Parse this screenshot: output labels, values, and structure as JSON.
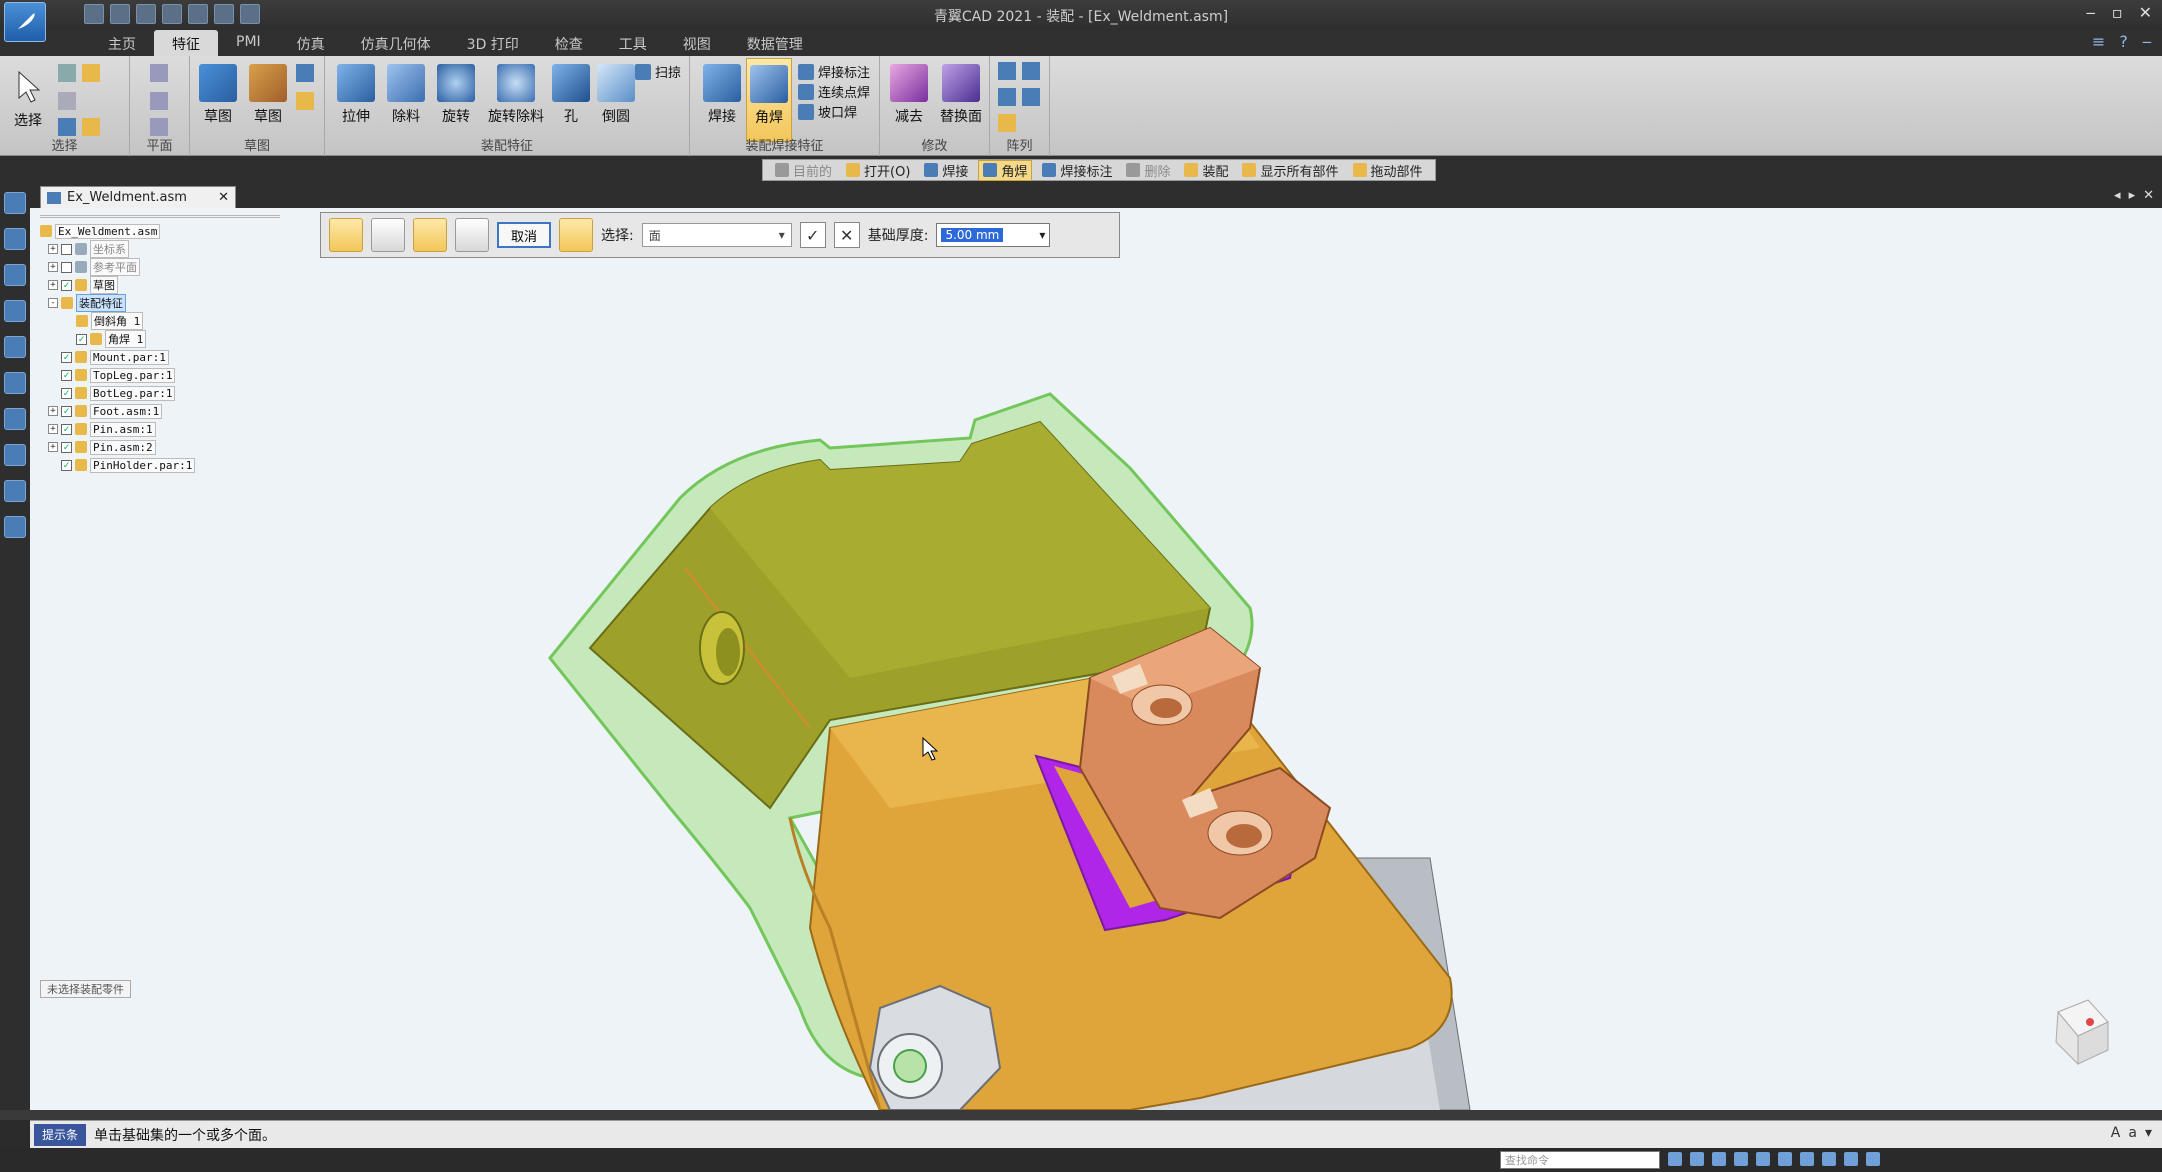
{
  "app": {
    "window_title": "青翼CAD 2021 - 装配 - [Ex_Weldment.asm]"
  },
  "ribbon_tabs": [
    "主页",
    "PMI",
    "仿真",
    "仿真几何体",
    "3D 打印",
    "检查",
    "工具",
    "视图",
    "数据管理"
  ],
  "active_tab": "特征",
  "ribbon": {
    "select_group": {
      "label": "选择",
      "button": "选择"
    },
    "plane_group": {
      "label": "平面"
    },
    "sketch_group": {
      "label": "草图",
      "sketch": "草图",
      "sketch2": "草图"
    },
    "assembly_features": {
      "label": "装配特征",
      "buttons": [
        "拉伸",
        "除料",
        "旋转",
        "旋转除料",
        "孔",
        "倒圆"
      ],
      "sweep": "扫掠"
    },
    "weld_features": {
      "label": "装配焊接特征",
      "weld": "焊接",
      "fillet_weld": "角焊",
      "weld_mark": "焊接标注",
      "stitch_weld": "连续点焊",
      "groove_weld": "坡口焊"
    },
    "modify": {
      "label": "修改",
      "subtract": "减去",
      "replace_face": "替换面"
    },
    "pattern": {
      "label": "阵列"
    }
  },
  "command_bar": [
    {
      "label": "目前的",
      "state": "dim"
    },
    {
      "label": "打开(O)",
      "state": "normal"
    },
    {
      "label": "焊接",
      "state": "normal"
    },
    {
      "label": "角焊",
      "state": "active"
    },
    {
      "label": "焊接标注",
      "state": "normal"
    },
    {
      "label": "删除",
      "state": "dim"
    },
    {
      "label": "装配",
      "state": "normal"
    },
    {
      "label": "显示所有部件",
      "state": "normal"
    },
    {
      "label": "拖动部件",
      "state": "normal"
    }
  ],
  "document_tab": "Ex_Weldment.asm",
  "tree": {
    "root": "Ex_Weldment.asm",
    "items": [
      {
        "label": "坐标系",
        "level": 1,
        "expand": "+",
        "check": false,
        "gray": true
      },
      {
        "label": "参考平面",
        "level": 1,
        "expand": "+",
        "check": false,
        "gray": true
      },
      {
        "label": "草图",
        "level": 1,
        "expand": "+",
        "check": true,
        "gray": false
      },
      {
        "label": "装配特征",
        "level": 1,
        "expand": "-",
        "check": null,
        "gray": false,
        "hl": true
      },
      {
        "label": "倒斜角 1",
        "level": 2,
        "expand": "",
        "check": null,
        "gray": false
      },
      {
        "label": "角焊 1",
        "level": 2,
        "expand": "",
        "check": true,
        "gray": false
      },
      {
        "label": "Mount.par:1",
        "level": 1,
        "expand": "",
        "check": true,
        "gray": false
      },
      {
        "label": "TopLeg.par:1",
        "level": 1,
        "expand": "",
        "check": true,
        "gray": false
      },
      {
        "label": "BotLeg.par:1",
        "level": 1,
        "expand": "",
        "check": true,
        "gray": false
      },
      {
        "label": "Foot.asm:1",
        "level": 1,
        "expand": "+",
        "check": true,
        "gray": false
      },
      {
        "label": "Pin.asm:1",
        "level": 1,
        "expand": "+",
        "check": true,
        "gray": false
      },
      {
        "label": "Pin.asm:2",
        "level": 1,
        "expand": "+",
        "check": true,
        "gray": false
      },
      {
        "label": "PinHolder.par:1",
        "level": 1,
        "expand": "",
        "check": true,
        "gray": false
      }
    ],
    "filter": "未选择装配零件"
  },
  "quickbar": {
    "cancel": "取消",
    "select_label": "选择:",
    "select_value": "面",
    "thickness_label": "基础厚度:",
    "thickness_value": "5.00 mm"
  },
  "prompt": {
    "label": "提示条",
    "text": "单击基础集的一个或多个面。"
  },
  "status": {
    "command_finder": "查找命令"
  },
  "colors": {
    "weld_highlight": "#b026e8",
    "body_gold": "#e0a53a",
    "transparent_green": "#7ed957",
    "bracket_copper": "#d98a5c"
  }
}
